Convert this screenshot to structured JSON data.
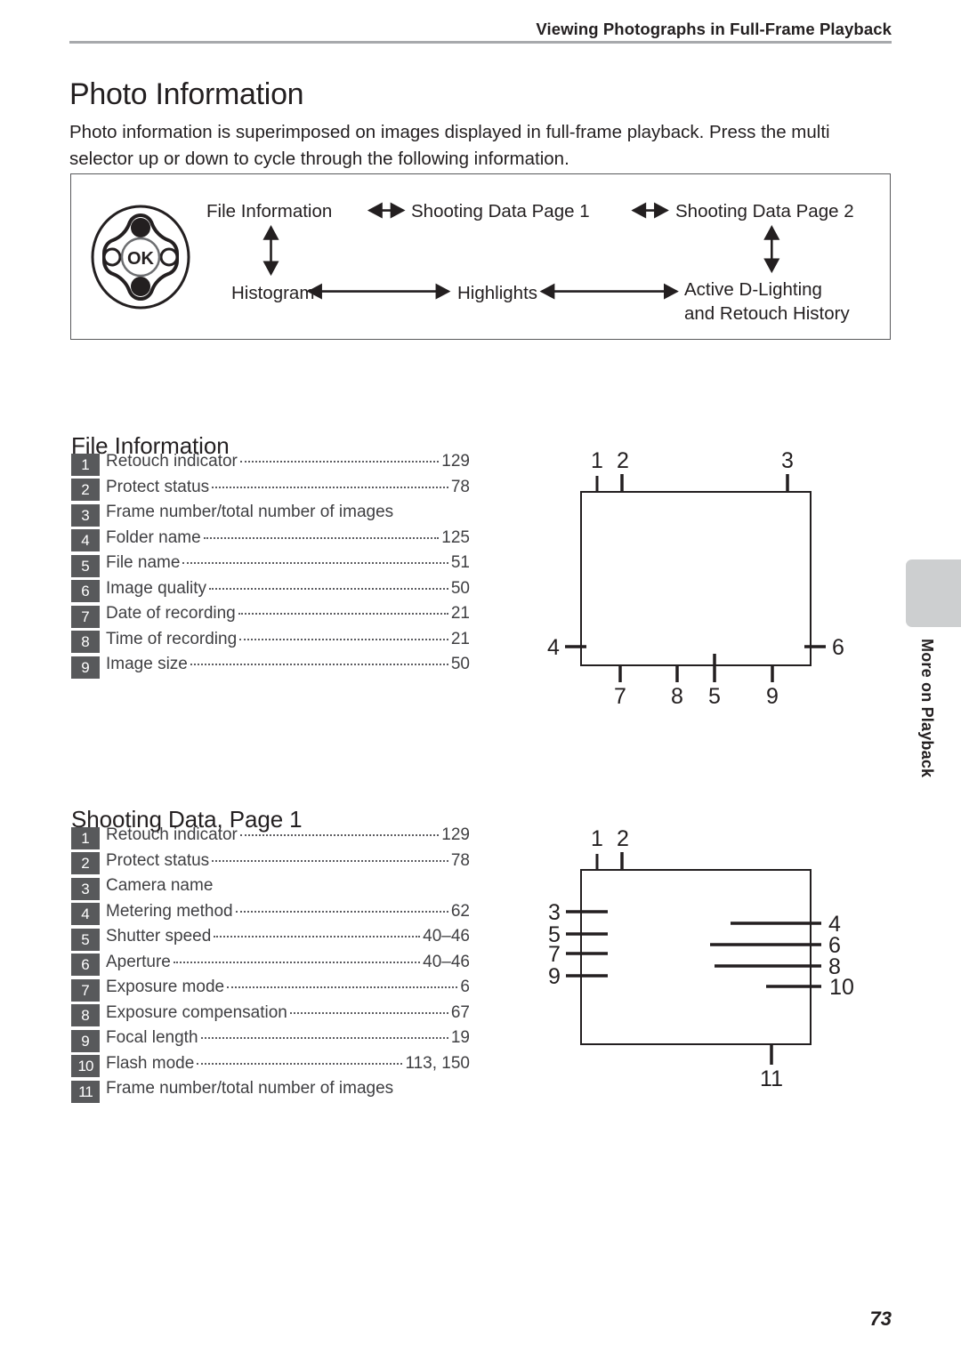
{
  "header": {
    "running_head": "Viewing Photographs in Full-Frame Playback"
  },
  "title": "Photo Information",
  "intro": "Photo information is superimposed on images displayed in full-frame playback. Press the multi selector up or down to cycle through the following information.",
  "flow": {
    "multi_selector_icon": "multi-selector-ok-pad",
    "ok_label": "OK",
    "nodes": {
      "file_information": "File Information",
      "shooting_data_page_1": "Shooting Data Page 1",
      "shooting_data_page_2": "Shooting Data Page 2",
      "histogram": "Histogram",
      "highlights": "Highlights",
      "active_d_lighting_line1": "Active D-Lighting",
      "active_d_lighting_line2": "and Retouch History"
    }
  },
  "sections": [
    {
      "heading": "File Information",
      "items": [
        {
          "num": "1",
          "label": "Retouch indicator",
          "page": "129"
        },
        {
          "num": "2",
          "label": "Protect status",
          "page": "78"
        },
        {
          "num": "3",
          "label": "Frame number/total number of images",
          "page": ""
        },
        {
          "num": "4",
          "label": "Folder name",
          "page": "125"
        },
        {
          "num": "5",
          "label": "File name",
          "page": "51"
        },
        {
          "num": "6",
          "label": "Image quality",
          "page": "50"
        },
        {
          "num": "7",
          "label": "Date of recording",
          "page": "21"
        },
        {
          "num": "8",
          "label": "Time of recording",
          "page": "21"
        },
        {
          "num": "9",
          "label": "Image size",
          "page": "50"
        }
      ],
      "figure_callouts": {
        "top": [
          "1",
          "2",
          "3"
        ],
        "left": [
          "4"
        ],
        "right": [
          "6"
        ],
        "bottom": [
          "7",
          "8",
          "5",
          "9"
        ]
      }
    },
    {
      "heading": "Shooting Data, Page 1",
      "items": [
        {
          "num": "1",
          "label": "Retouch indicator",
          "page": "129"
        },
        {
          "num": "2",
          "label": "Protect status",
          "page": "78"
        },
        {
          "num": "3",
          "label": "Camera name",
          "page": ""
        },
        {
          "num": "4",
          "label": "Metering method",
          "page": "62"
        },
        {
          "num": "5",
          "label": "Shutter speed",
          "page": "40–46"
        },
        {
          "num": "6",
          "label": "Aperture",
          "page": "40–46"
        },
        {
          "num": "7",
          "label": "Exposure mode",
          "page": "6"
        },
        {
          "num": "8",
          "label": "Exposure compensation",
          "page": "67"
        },
        {
          "num": "9",
          "label": "Focal length",
          "page": "19"
        },
        {
          "num": "10",
          "label": "Flash mode",
          "page": "113, 150"
        },
        {
          "num": "11",
          "label": "Frame number/total number of images",
          "page": ""
        }
      ],
      "figure_callouts": {
        "top": [
          "1",
          "2"
        ],
        "left": [
          "3",
          "5",
          "7",
          "9"
        ],
        "right": [
          "4",
          "6",
          "8",
          "10"
        ],
        "bottom": [
          "11"
        ]
      }
    }
  ],
  "side_tab": {
    "label": "More on Playback"
  },
  "folio": "73",
  "colors": {
    "badge_bg": "#58595b",
    "rule": "#a7a9ac",
    "tab_bg": "#cdcfd0",
    "ink": "#231f20"
  }
}
